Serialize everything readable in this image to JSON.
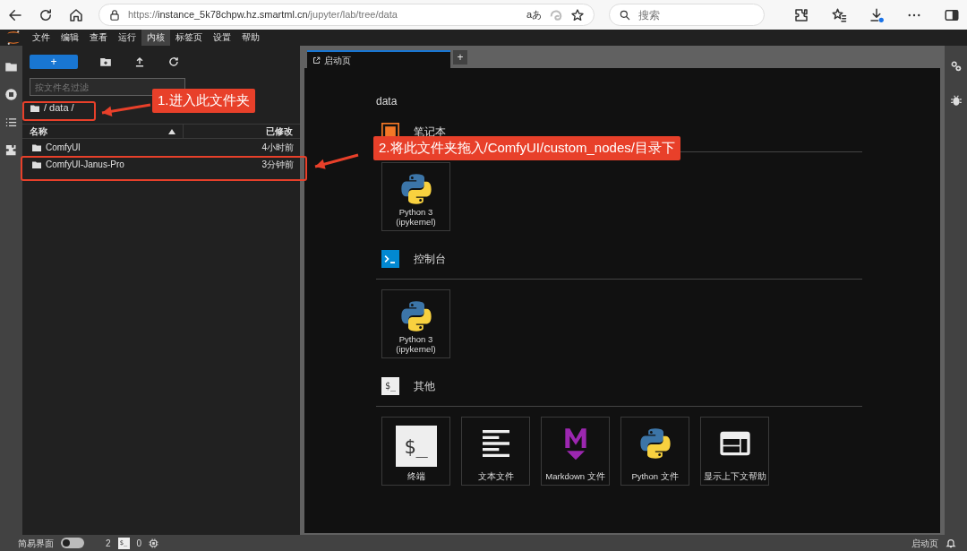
{
  "browser": {
    "url": {
      "scheme": "https://",
      "host": "instance_5k78chpw.hz.smartml.cn",
      "path": "/jupyter/lab/tree/data"
    },
    "translate_glyph": "aあ",
    "search_placeholder": "搜索"
  },
  "menu": [
    {
      "label": "文件",
      "selected": false
    },
    {
      "label": "编辑",
      "selected": false
    },
    {
      "label": "查看",
      "selected": false
    },
    {
      "label": "运行",
      "selected": false
    },
    {
      "label": "内核",
      "selected": true
    },
    {
      "label": "标签页",
      "selected": false
    },
    {
      "label": "设置",
      "selected": false
    },
    {
      "label": "帮助",
      "selected": false
    }
  ],
  "file_browser": {
    "new_button": "+",
    "filter_placeholder": "按文件名过滤",
    "breadcrumb": "/ data /",
    "columns": [
      {
        "label": "名称",
        "sorted": true
      },
      {
        "label": "已修改",
        "sorted": false
      }
    ],
    "rows": [
      {
        "name": "ComfyUI",
        "modified": "4小时前"
      },
      {
        "name": "ComfyUI-Janus-Pro",
        "modified": "3分钟前"
      }
    ]
  },
  "tabs": [
    {
      "label": "启动页",
      "selected": true
    }
  ],
  "launcher": {
    "title": "data",
    "sections": [
      {
        "title": "笔记本",
        "kind": "notebook",
        "cards": [
          {
            "label": "Python 3\n(ipykernel)",
            "kind": "python"
          }
        ]
      },
      {
        "title": "控制台",
        "kind": "console",
        "cards": [
          {
            "label": "Python 3\n(ipykernel)",
            "kind": "python"
          }
        ]
      },
      {
        "title": "其他",
        "kind": "other",
        "icon_text": "$_",
        "cards": [
          {
            "label": "终端",
            "kind": "terminal",
            "icon_text": "$_"
          },
          {
            "label": "文本文件",
            "kind": "text"
          },
          {
            "label": "Markdown 文件",
            "kind": "markdown"
          },
          {
            "label": "Python 文件",
            "kind": "python"
          },
          {
            "label": "显示上下文帮助",
            "kind": "help"
          }
        ]
      }
    ]
  },
  "status_bar": {
    "simple_mode": {
      "label": "简易界面",
      "on": false
    },
    "kernels": "2",
    "terminal_icon_text": "$_",
    "terminals": "0",
    "active_tab": "启动页"
  },
  "annotations": [
    {
      "text": "1.进入此文件夹"
    },
    {
      "text": "2.将此文件夹拖入/ComfyUI/custom_nodes/目录下"
    }
  ]
}
